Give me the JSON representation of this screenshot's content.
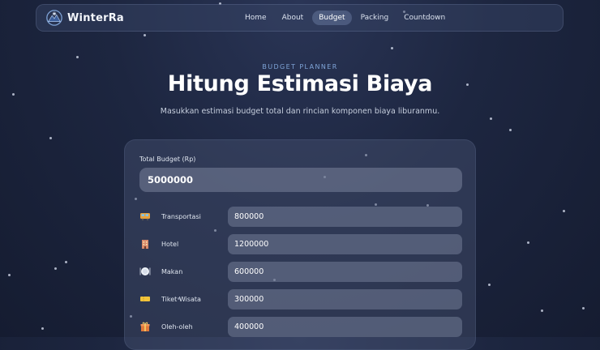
{
  "brand": {
    "name": "WinterRa",
    "icon": "snowflake-mountain-logo"
  },
  "nav": [
    {
      "label": "Home",
      "active": false
    },
    {
      "label": "About",
      "active": false
    },
    {
      "label": "Budget",
      "active": true
    },
    {
      "label": "Packing",
      "active": false
    },
    {
      "label": "Countdown",
      "active": false
    }
  ],
  "hero": {
    "eyebrow": "BUDGET PLANNER",
    "title": "Hitung Estimasi Biaya",
    "subtitle": "Masukkan estimasi budget total dan rincian komponen biaya liburanmu."
  },
  "form": {
    "total_label": "Total Budget (Rp)",
    "total_value": "5000000",
    "rows": [
      {
        "label": "Transportasi",
        "value": "800000",
        "icon": "tram-icon"
      },
      {
        "label": "Hotel",
        "value": "1200000",
        "icon": "hotel-icon"
      },
      {
        "label": "Makan",
        "value": "600000",
        "icon": "plate-icon"
      },
      {
        "label": "Tiket Wisata",
        "value": "300000",
        "icon": "ticket-icon"
      },
      {
        "label": "Oleh-oleh",
        "value": "400000",
        "icon": "gift-icon"
      }
    ]
  },
  "colors": {
    "accent": "#7fa4d8",
    "background": "#1d2640"
  }
}
